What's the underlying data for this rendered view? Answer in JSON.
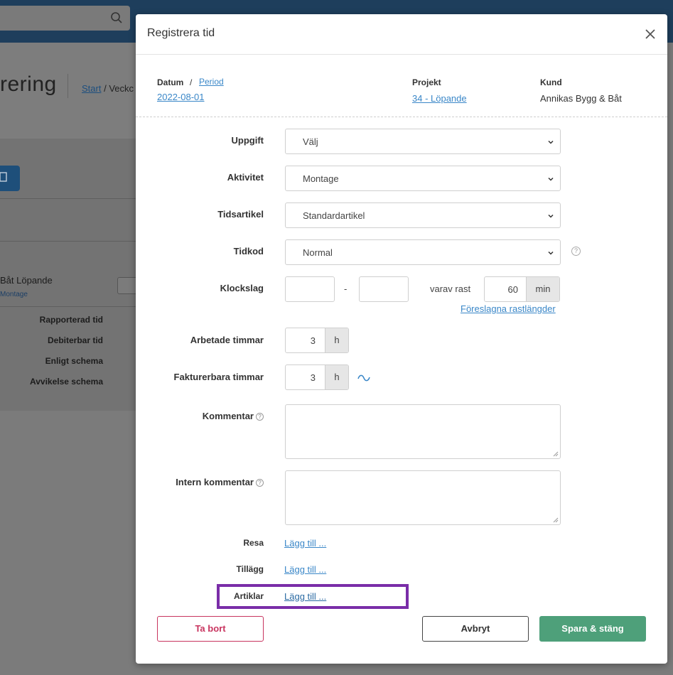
{
  "background": {
    "title_fragment": "rering",
    "breadcrumb_start": "Start",
    "breadcrumb_sep": " / ",
    "breadcrumb_current": "Veckc",
    "project_name": "Båt Löpande",
    "project_activity": "Montage",
    "rows": [
      "Rapporterad tid",
      "Debiterbar tid",
      "Enligt schema",
      "Avvikelse schema"
    ]
  },
  "modal": {
    "title": "Registrera tid",
    "info": {
      "datum_label": "Datum",
      "separator": "/",
      "period_link": "Period",
      "date_value": "2022-08-01",
      "projekt_label": "Projekt",
      "projekt_value": "34 - Löpande",
      "kund_label": "Kund",
      "kund_value": "Annikas Bygg & Båt"
    },
    "form": {
      "uppgift_label": "Uppgift",
      "uppgift_value": "Välj",
      "aktivitet_label": "Aktivitet",
      "aktivitet_value": "Montage",
      "tidsartikel_label": "Tidsartikel",
      "tidsartikel_value": "Standardartikel",
      "tidkod_label": "Tidkod",
      "tidkod_value": "Normal",
      "klockslag_label": "Klockslag",
      "klockslag_dash": "-",
      "rast_label": "varav rast",
      "rast_value": "60",
      "rast_unit": "min",
      "rast_suggest_link": "Föreslagna rastlängder",
      "arbetade_label": "Arbetade timmar",
      "arbetade_value": "3",
      "arbetade_unit": "h",
      "fakturerbara_label": "Fakturerbara timmar",
      "fakturerbara_value": "3",
      "fakturerbara_unit": "h",
      "kommentar_label": "Kommentar",
      "intern_label": "Intern kommentar",
      "resa_label": "Resa",
      "resa_link": "Lägg till ...",
      "tillagg_label": "Tillägg",
      "tillagg_link": "Lägg till ...",
      "artiklar_label": "Artiklar",
      "artiklar_link": "Lägg till ..."
    },
    "buttons": {
      "delete": "Ta bort",
      "cancel": "Avbryt",
      "save": "Spara & stäng"
    }
  },
  "colors": {
    "topbar": "#1e3e5c",
    "link": "#3a87c8",
    "delete": "#c8345f",
    "save": "#4ea07a",
    "highlight": "#7a2da8"
  }
}
